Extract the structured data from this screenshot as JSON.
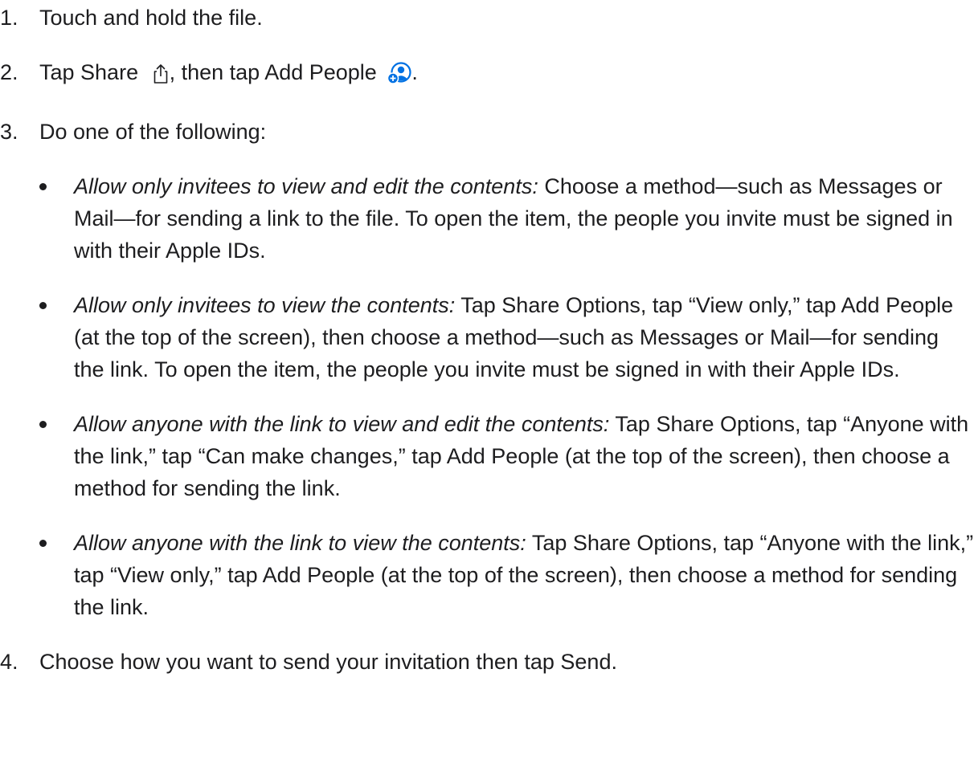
{
  "steps": [
    {
      "num": "1.",
      "text": "Touch and hold the file."
    },
    {
      "num": "2.",
      "parts": [
        "Tap Share",
        ", then tap Add People",
        "."
      ]
    },
    {
      "num": "3.",
      "text": "Do one of the following:"
    },
    {
      "num": "4.",
      "text": "Choose how you want to send your invitation then tap Send."
    }
  ],
  "options": [
    {
      "lead": "Allow only invitees to view and edit the contents:",
      "text": " Choose a method—such as Messages or Mail—for sending a link to the file. To open the item, the people you invite must be signed in with their Apple IDs."
    },
    {
      "lead": "Allow only invitees to view the contents:",
      "text": " Tap Share Options, tap “View only,” tap Add People (at the top of the screen), then choose a method—such as Messages or Mail—for sending the link. To open the item, the people you invite must be signed in with their Apple IDs."
    },
    {
      "lead": "Allow anyone with the link to view and edit the contents:",
      "text": " Tap Share Options, tap “Anyone with the link,” tap “Can make changes,” tap Add People (at the top of the screen), then choose a method for sending the link."
    },
    {
      "lead": "Allow anyone with the link to view the contents:",
      "text": " Tap Share Options, tap “Anyone with the link,” tap “View only,” tap Add People (at the top of the screen), then choose a method for sending the link."
    }
  ],
  "icons": {
    "share": "share-icon",
    "add_people": "add-people-icon"
  },
  "colors": {
    "text": "#1d1d1f",
    "icon_blue": "#0071e3",
    "background": "#ffffff"
  }
}
